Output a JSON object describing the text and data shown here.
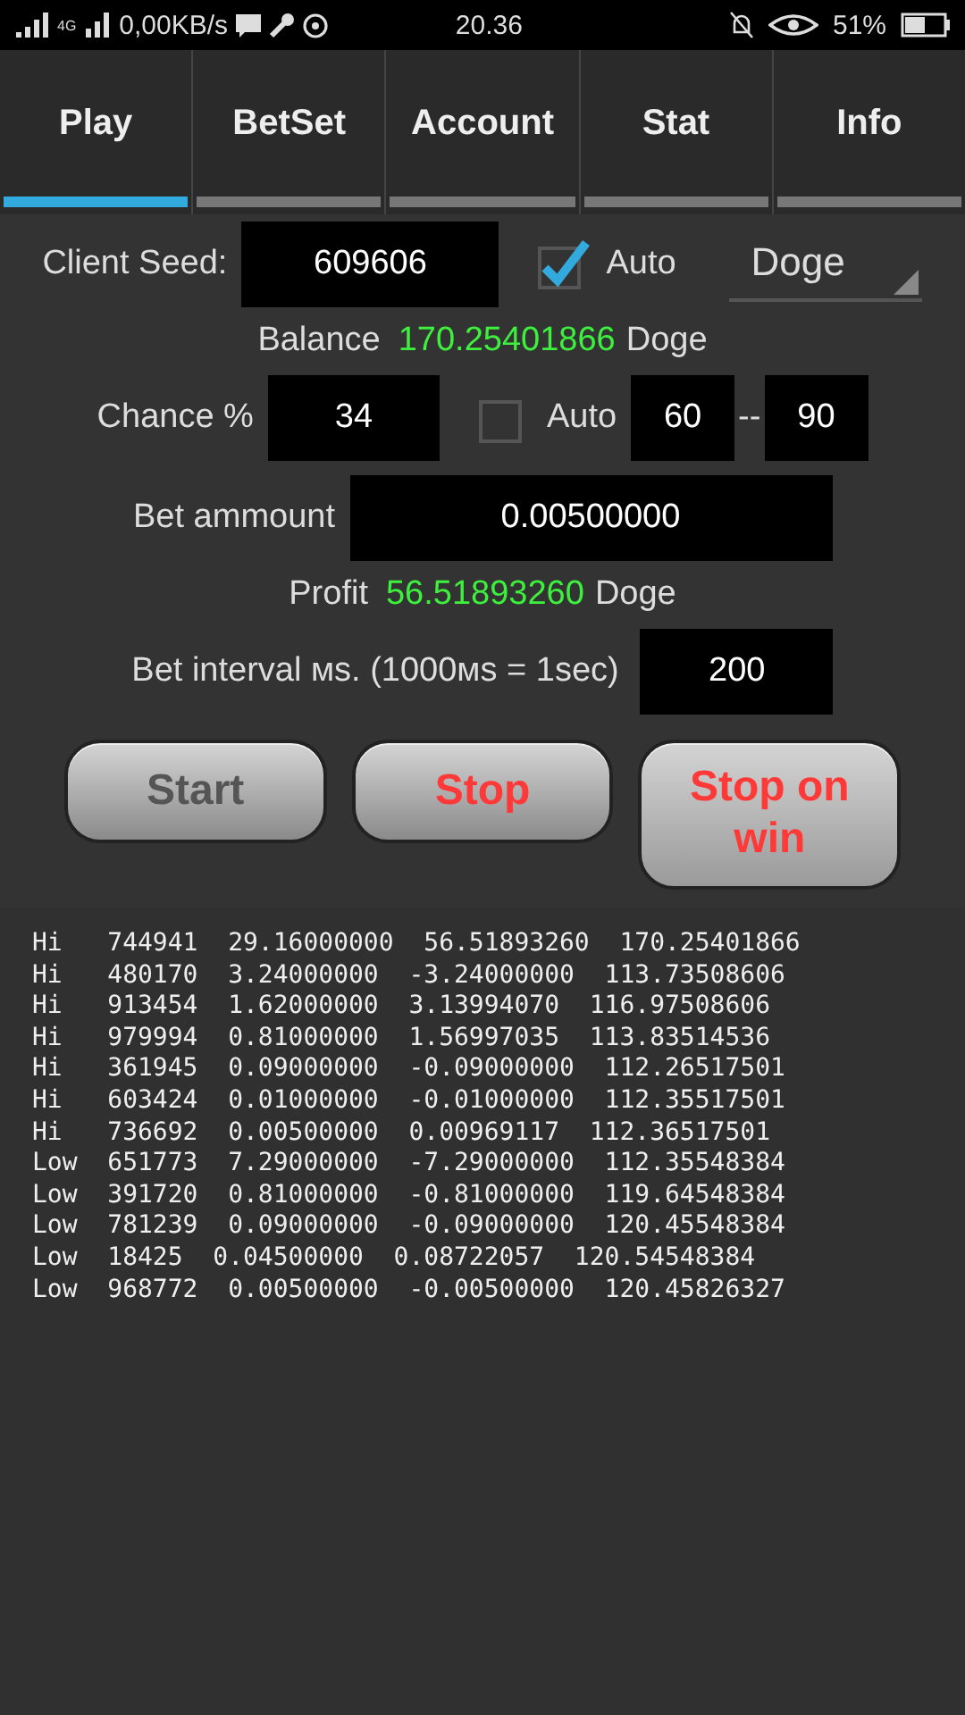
{
  "status_bar": {
    "network": "4G",
    "speed": "0,00KB/s",
    "time": "20.36",
    "battery": "51%"
  },
  "tabs": [
    {
      "label": "Play",
      "selected": true
    },
    {
      "label": "BetSet",
      "selected": false
    },
    {
      "label": "Account",
      "selected": false
    },
    {
      "label": "Stat",
      "selected": false
    },
    {
      "label": "Info",
      "selected": false
    }
  ],
  "client_seed": {
    "label": "Client Seed:",
    "value": "609606",
    "auto_label": "Auto",
    "auto_checked": true,
    "currency": "Doge"
  },
  "balance": {
    "label": "Balance",
    "value": "170.25401866",
    "unit": "Doge"
  },
  "chance": {
    "label": "Chance %",
    "value": "34",
    "auto_label": "Auto",
    "auto_checked": false,
    "min": "60",
    "separator": "--",
    "max": "90"
  },
  "bet_amount": {
    "label": "Bet ammount",
    "value": "0.00500000"
  },
  "profit": {
    "label": "Profit",
    "value": "56.51893260",
    "unit": "Doge"
  },
  "bet_interval": {
    "label": "Bet interval мs. (1000мs = 1sec)",
    "value": "200"
  },
  "buttons": [
    {
      "label": "Start",
      "disabled": true
    },
    {
      "label": "Stop",
      "disabled": false
    },
    {
      "label": "Stop on win",
      "disabled": false
    }
  ],
  "log": [
    "Hi   744941  29.16000000  56.51893260  170.25401866",
    "Hi   480170  3.24000000  -3.24000000  113.73508606",
    "Hi   913454  1.62000000  3.13994070  116.97508606",
    "Hi   979994  0.81000000  1.56997035  113.83514536",
    "Hi   361945  0.09000000  -0.09000000  112.26517501",
    "Hi   603424  0.01000000  -0.01000000  112.35517501",
    "Hi   736692  0.00500000  0.00969117  112.36517501",
    "Low  651773  7.29000000  -7.29000000  112.35548384",
    "Low  391720  0.81000000  -0.81000000  119.64548384",
    "Low  781239  0.09000000  -0.09000000  120.45548384",
    "Low  18425  0.04500000  0.08722057  120.54548384",
    "Low  968772  0.00500000  -0.00500000  120.45826327"
  ]
}
